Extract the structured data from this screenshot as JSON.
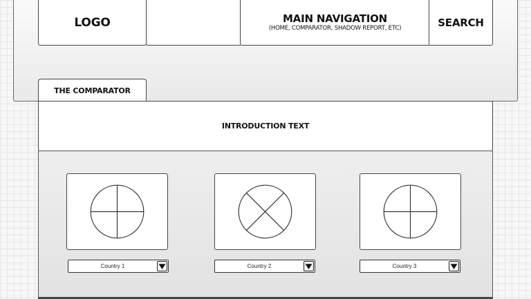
{
  "header": {
    "logo": "LOGO",
    "nav_title": "MAIN NAVIGATION",
    "nav_subtitle": "(HOME, COMPARATOR, SHADOW REPORT, ETC)",
    "search": "SEARCH"
  },
  "tab": {
    "label": "THE COMPARATOR"
  },
  "intro": {
    "text": "INTRODUCTION TEXT"
  },
  "comparators": [
    {
      "chart_icon": "pie-chart-placeholder-icon",
      "select_value": "Country 1"
    },
    {
      "chart_icon": "image-placeholder-icon",
      "select_value": "Country 2"
    },
    {
      "chart_icon": "pie-chart-placeholder-icon",
      "select_value": "Country 3"
    }
  ]
}
